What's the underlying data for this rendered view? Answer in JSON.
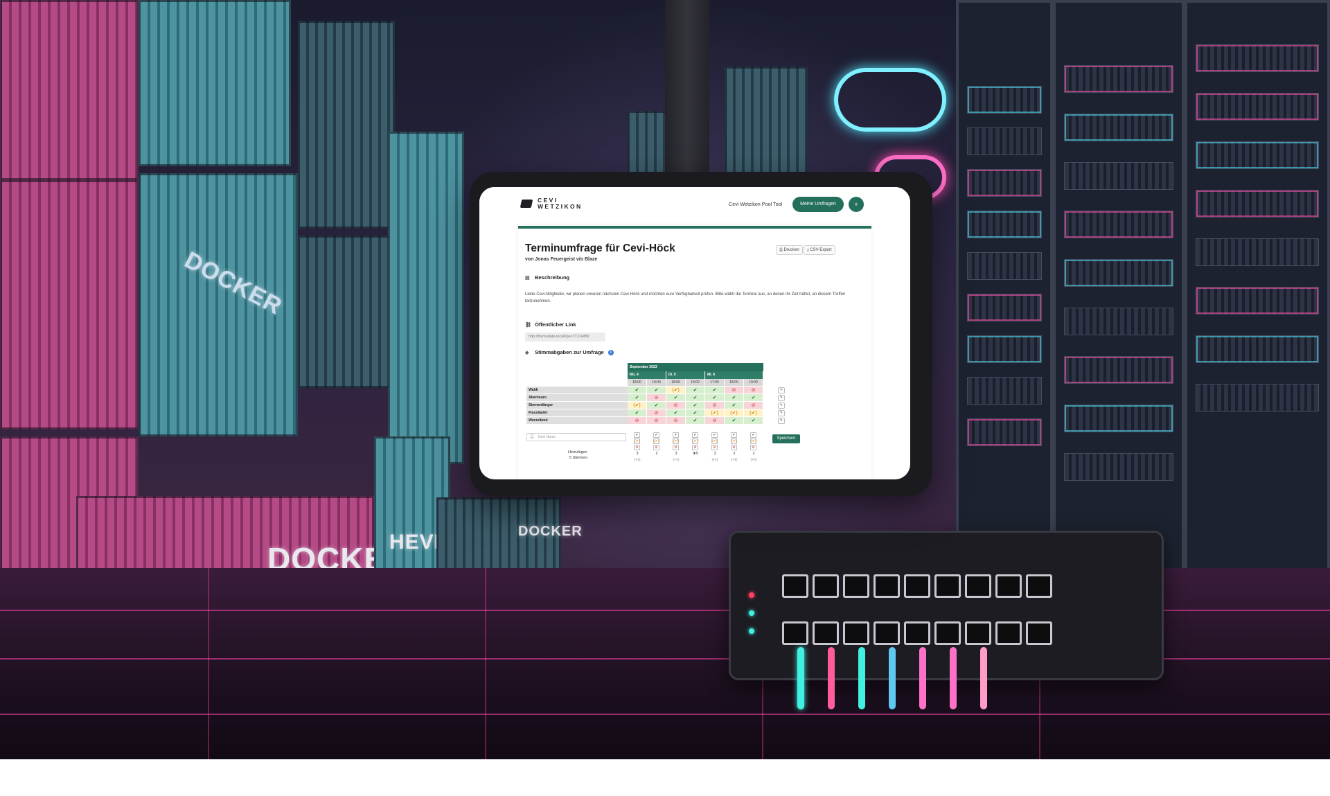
{
  "brand": {
    "line1": "CEVI",
    "line2": "WETZIKON"
  },
  "nav": {
    "link": "Cevi Wetzikon Pool Tool",
    "my_polls": "Meine Umfragen",
    "add": "+"
  },
  "poll": {
    "title": "Terminumfrage für Cevi-Höck",
    "author": "von Jonas Feuergeist v/o Blaze",
    "print_button": "Drucken",
    "export_button": "CSV-Export",
    "description_heading": "Beschreibung",
    "description": "Liebe Cevi-Mitglieder, wir planen unseren nächsten Cevi-Höck und möchten eure Verfügbarkeit prüfen. Bitte wählt die Termine aus, an denen ihr Zeit hättet, an diesem Treffen teilzunehmen.",
    "public_link_heading": "Öffentlicher Link",
    "public_link": "http://framadate.local/Qeo7T21Hf89",
    "votes_heading": "Stimmabgaben zur Umfrage",
    "month": "September 2023",
    "days": [
      "Mo. 4",
      "Di. 5",
      "Mi. 6"
    ],
    "times": [
      "18:00",
      "19:00",
      "18:00",
      "19:00",
      "17:00",
      "18:00",
      "19:00"
    ],
    "participants": [
      {
        "name": "Waldi",
        "votes": [
          "yes",
          "yes",
          "maybe",
          "yes",
          "yes",
          "no",
          "no"
        ]
      },
      {
        "name": "Abenteuro",
        "votes": [
          "yes",
          "no",
          "yes",
          "yes",
          "yes",
          "yes",
          "yes"
        ]
      },
      {
        "name": "Sternenfänger",
        "votes": [
          "maybe",
          "yes",
          "no",
          "yes",
          "no",
          "yes",
          "no"
        ]
      },
      {
        "name": "Flussläufer",
        "votes": [
          "yes",
          "no",
          "yes",
          "yes",
          "maybe",
          "maybe",
          "maybe"
        ]
      },
      {
        "name": "Wurzelkind",
        "votes": [
          "no",
          "no",
          "no",
          "yes",
          "no",
          "yes",
          "yes"
        ]
      }
    ],
    "name_placeholder": "Dein Name",
    "save_button": "Speichern",
    "add_label": "Hinzufügen",
    "votes_count_label": "5 Stimmen",
    "totals": [
      "3",
      "2",
      "3",
      "5",
      "3",
      "2",
      "2"
    ],
    "totals_sub": [
      "(+1)",
      "",
      "(+1)",
      "",
      "(+1)",
      "(+1)",
      "(+2)"
    ],
    "best_marker": "★"
  },
  "scene": {
    "crate_label_1": "DOCKER",
    "crate_label_2": "HEVK",
    "crate_label_3": "DOCKER",
    "crate_label_4": "DOCKER",
    "accent_pink": "#ff46aa",
    "accent_cyan": "#50dcf0",
    "brand_green": "#24705c"
  }
}
